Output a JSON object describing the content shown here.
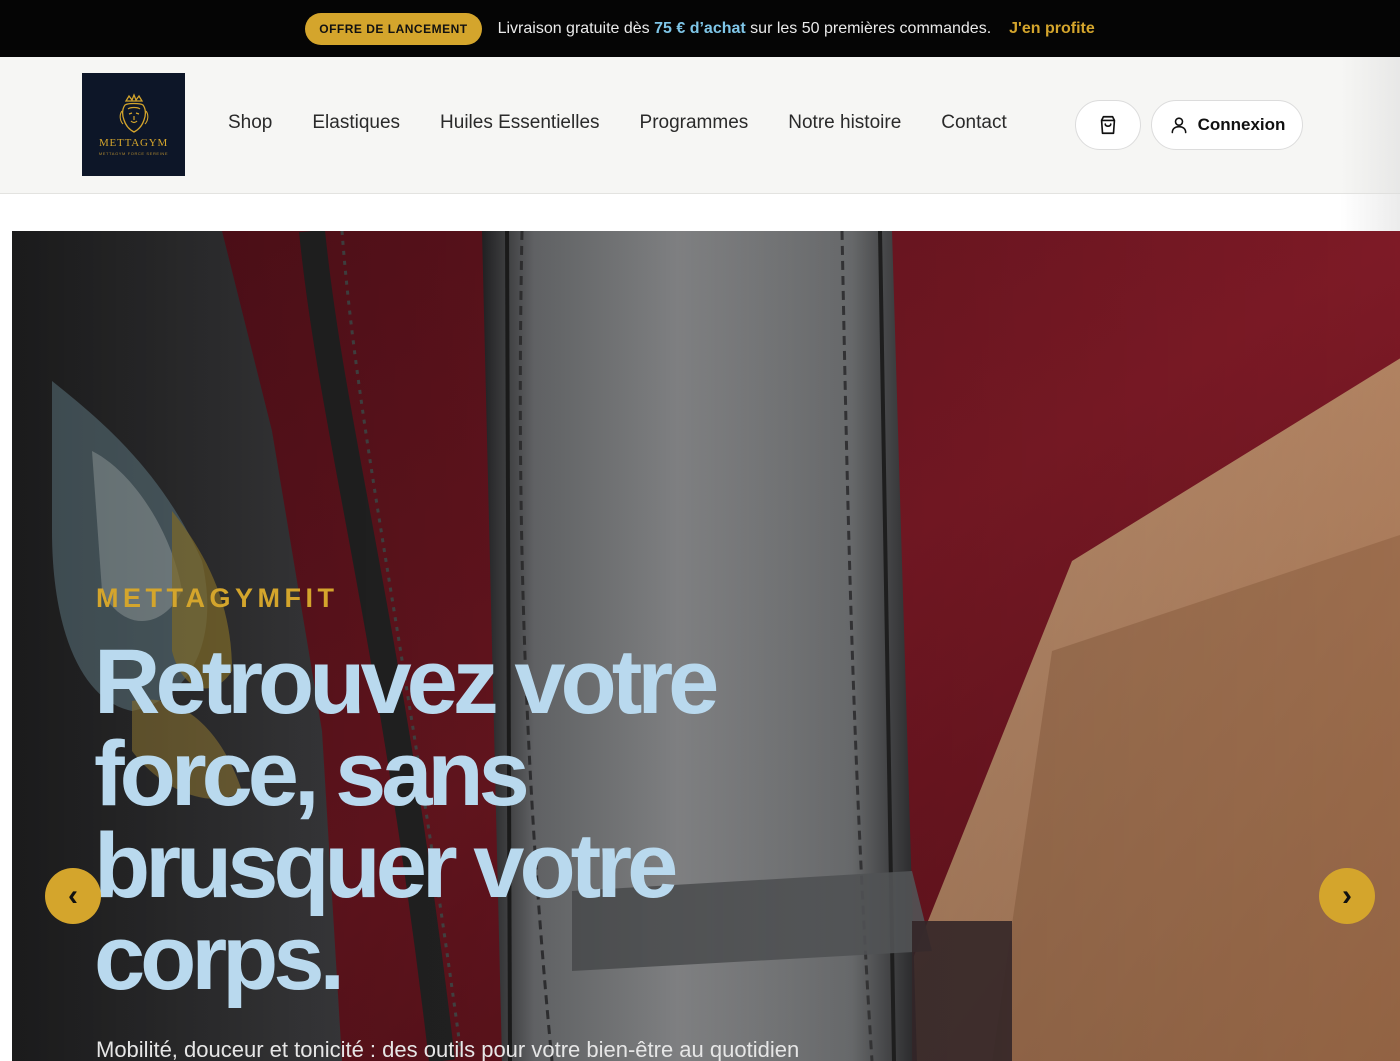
{
  "announcement": {
    "badge": "OFFRE DE LANCEMENT",
    "message_before": "Livraison gratuite dès ",
    "message_highlight": "75 € d’achat",
    "message_after": " sur les 50 premières commandes.",
    "cta": "J'en profite"
  },
  "header": {
    "logo_brand": "METTAGYM",
    "logo_tagline": "Mettagym force sereine",
    "nav": [
      {
        "label": "Shop"
      },
      {
        "label": "Elastiques"
      },
      {
        "label": "Huiles Essentielles"
      },
      {
        "label": "Programmes"
      },
      {
        "label": "Notre histoire"
      },
      {
        "label": "Contact"
      }
    ],
    "login_label": "Connexion"
  },
  "hero": {
    "eyebrow": "METTAGYMFIT",
    "headline": "Retrouvez votre force, sans brusquer votre corps.",
    "subline": "Mobilité, douceur et tonicité : des outils pour votre bien-être au quotidien",
    "prev_arrow": "‹",
    "next_arrow": "›"
  },
  "colors": {
    "accent_gold": "#d4a52c",
    "headline_blue": "#b9d9ee",
    "highlight_blue": "#7fc6e8",
    "dark": "#050505"
  },
  "icons": [
    "lion-crown-logo-icon",
    "shopping-bag-icon",
    "user-icon",
    "chevron-left-icon",
    "chevron-right-icon"
  ]
}
